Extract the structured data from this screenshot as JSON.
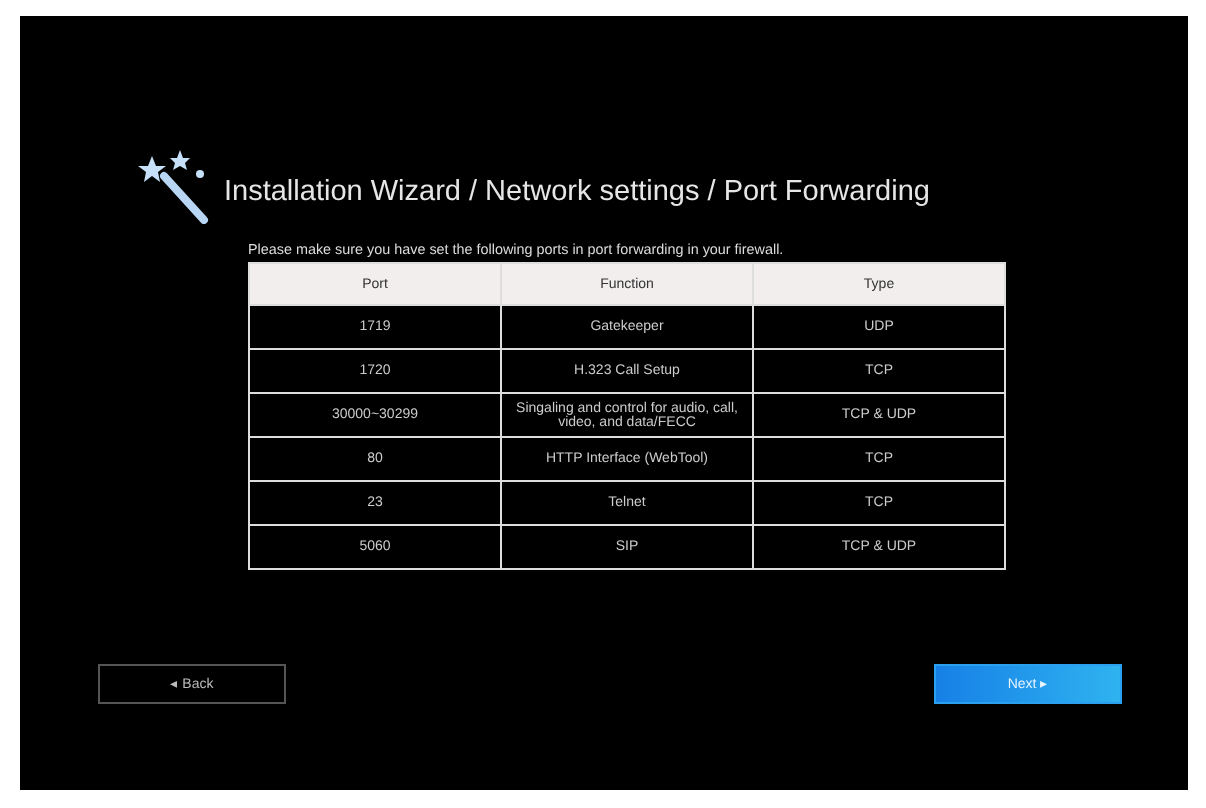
{
  "title": "Installation Wizard / Network settings / Port Forwarding",
  "instruction": "Please make sure you have set the following ports in port forwarding in your firewall.",
  "table": {
    "columns": [
      "Port",
      "Function",
      "Type"
    ],
    "rows": [
      [
        "1719",
        "Gatekeeper",
        "UDP"
      ],
      [
        "1720",
        "H.323 Call Setup",
        "TCP"
      ],
      [
        "30000~30299",
        "Singaling and control for audio, call, video, and data/FECC",
        "TCP & UDP"
      ],
      [
        "80",
        "HTTP Interface (WebTool)",
        "TCP"
      ],
      [
        "23",
        "Telnet",
        "TCP"
      ],
      [
        "5060",
        "SIP",
        "TCP & UDP"
      ]
    ]
  },
  "buttons": [
    {
      "label": "◂ Back",
      "kind": "secondary"
    },
    {
      "label": "Next ▸",
      "kind": "primary"
    }
  ]
}
